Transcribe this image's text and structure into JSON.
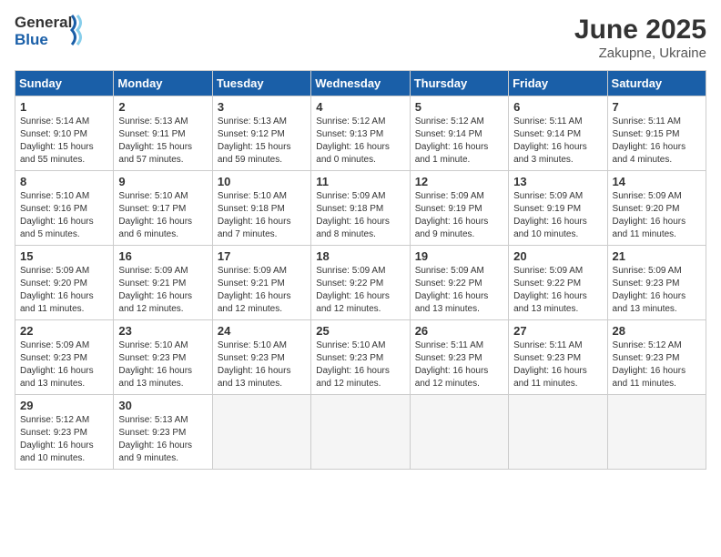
{
  "header": {
    "logo_general": "General",
    "logo_blue": "Blue",
    "month": "June 2025",
    "location": "Zakupne, Ukraine"
  },
  "weekdays": [
    "Sunday",
    "Monday",
    "Tuesday",
    "Wednesday",
    "Thursday",
    "Friday",
    "Saturday"
  ],
  "weeks": [
    [
      {
        "day": "1",
        "info": "Sunrise: 5:14 AM\nSunset: 9:10 PM\nDaylight: 15 hours\nand 55 minutes."
      },
      {
        "day": "2",
        "info": "Sunrise: 5:13 AM\nSunset: 9:11 PM\nDaylight: 15 hours\nand 57 minutes."
      },
      {
        "day": "3",
        "info": "Sunrise: 5:13 AM\nSunset: 9:12 PM\nDaylight: 15 hours\nand 59 minutes."
      },
      {
        "day": "4",
        "info": "Sunrise: 5:12 AM\nSunset: 9:13 PM\nDaylight: 16 hours\nand 0 minutes."
      },
      {
        "day": "5",
        "info": "Sunrise: 5:12 AM\nSunset: 9:14 PM\nDaylight: 16 hours\nand 1 minute."
      },
      {
        "day": "6",
        "info": "Sunrise: 5:11 AM\nSunset: 9:14 PM\nDaylight: 16 hours\nand 3 minutes."
      },
      {
        "day": "7",
        "info": "Sunrise: 5:11 AM\nSunset: 9:15 PM\nDaylight: 16 hours\nand 4 minutes."
      }
    ],
    [
      {
        "day": "8",
        "info": "Sunrise: 5:10 AM\nSunset: 9:16 PM\nDaylight: 16 hours\nand 5 minutes."
      },
      {
        "day": "9",
        "info": "Sunrise: 5:10 AM\nSunset: 9:17 PM\nDaylight: 16 hours\nand 6 minutes."
      },
      {
        "day": "10",
        "info": "Sunrise: 5:10 AM\nSunset: 9:18 PM\nDaylight: 16 hours\nand 7 minutes."
      },
      {
        "day": "11",
        "info": "Sunrise: 5:09 AM\nSunset: 9:18 PM\nDaylight: 16 hours\nand 8 minutes."
      },
      {
        "day": "12",
        "info": "Sunrise: 5:09 AM\nSunset: 9:19 PM\nDaylight: 16 hours\nand 9 minutes."
      },
      {
        "day": "13",
        "info": "Sunrise: 5:09 AM\nSunset: 9:19 PM\nDaylight: 16 hours\nand 10 minutes."
      },
      {
        "day": "14",
        "info": "Sunrise: 5:09 AM\nSunset: 9:20 PM\nDaylight: 16 hours\nand 11 minutes."
      }
    ],
    [
      {
        "day": "15",
        "info": "Sunrise: 5:09 AM\nSunset: 9:20 PM\nDaylight: 16 hours\nand 11 minutes."
      },
      {
        "day": "16",
        "info": "Sunrise: 5:09 AM\nSunset: 9:21 PM\nDaylight: 16 hours\nand 12 minutes."
      },
      {
        "day": "17",
        "info": "Sunrise: 5:09 AM\nSunset: 9:21 PM\nDaylight: 16 hours\nand 12 minutes."
      },
      {
        "day": "18",
        "info": "Sunrise: 5:09 AM\nSunset: 9:22 PM\nDaylight: 16 hours\nand 12 minutes."
      },
      {
        "day": "19",
        "info": "Sunrise: 5:09 AM\nSunset: 9:22 PM\nDaylight: 16 hours\nand 13 minutes."
      },
      {
        "day": "20",
        "info": "Sunrise: 5:09 AM\nSunset: 9:22 PM\nDaylight: 16 hours\nand 13 minutes."
      },
      {
        "day": "21",
        "info": "Sunrise: 5:09 AM\nSunset: 9:23 PM\nDaylight: 16 hours\nand 13 minutes."
      }
    ],
    [
      {
        "day": "22",
        "info": "Sunrise: 5:09 AM\nSunset: 9:23 PM\nDaylight: 16 hours\nand 13 minutes."
      },
      {
        "day": "23",
        "info": "Sunrise: 5:10 AM\nSunset: 9:23 PM\nDaylight: 16 hours\nand 13 minutes."
      },
      {
        "day": "24",
        "info": "Sunrise: 5:10 AM\nSunset: 9:23 PM\nDaylight: 16 hours\nand 13 minutes."
      },
      {
        "day": "25",
        "info": "Sunrise: 5:10 AM\nSunset: 9:23 PM\nDaylight: 16 hours\nand 12 minutes."
      },
      {
        "day": "26",
        "info": "Sunrise: 5:11 AM\nSunset: 9:23 PM\nDaylight: 16 hours\nand 12 minutes."
      },
      {
        "day": "27",
        "info": "Sunrise: 5:11 AM\nSunset: 9:23 PM\nDaylight: 16 hours\nand 11 minutes."
      },
      {
        "day": "28",
        "info": "Sunrise: 5:12 AM\nSunset: 9:23 PM\nDaylight: 16 hours\nand 11 minutes."
      }
    ],
    [
      {
        "day": "29",
        "info": "Sunrise: 5:12 AM\nSunset: 9:23 PM\nDaylight: 16 hours\nand 10 minutes."
      },
      {
        "day": "30",
        "info": "Sunrise: 5:13 AM\nSunset: 9:23 PM\nDaylight: 16 hours\nand 9 minutes."
      },
      {
        "day": "",
        "info": ""
      },
      {
        "day": "",
        "info": ""
      },
      {
        "day": "",
        "info": ""
      },
      {
        "day": "",
        "info": ""
      },
      {
        "day": "",
        "info": ""
      }
    ]
  ]
}
